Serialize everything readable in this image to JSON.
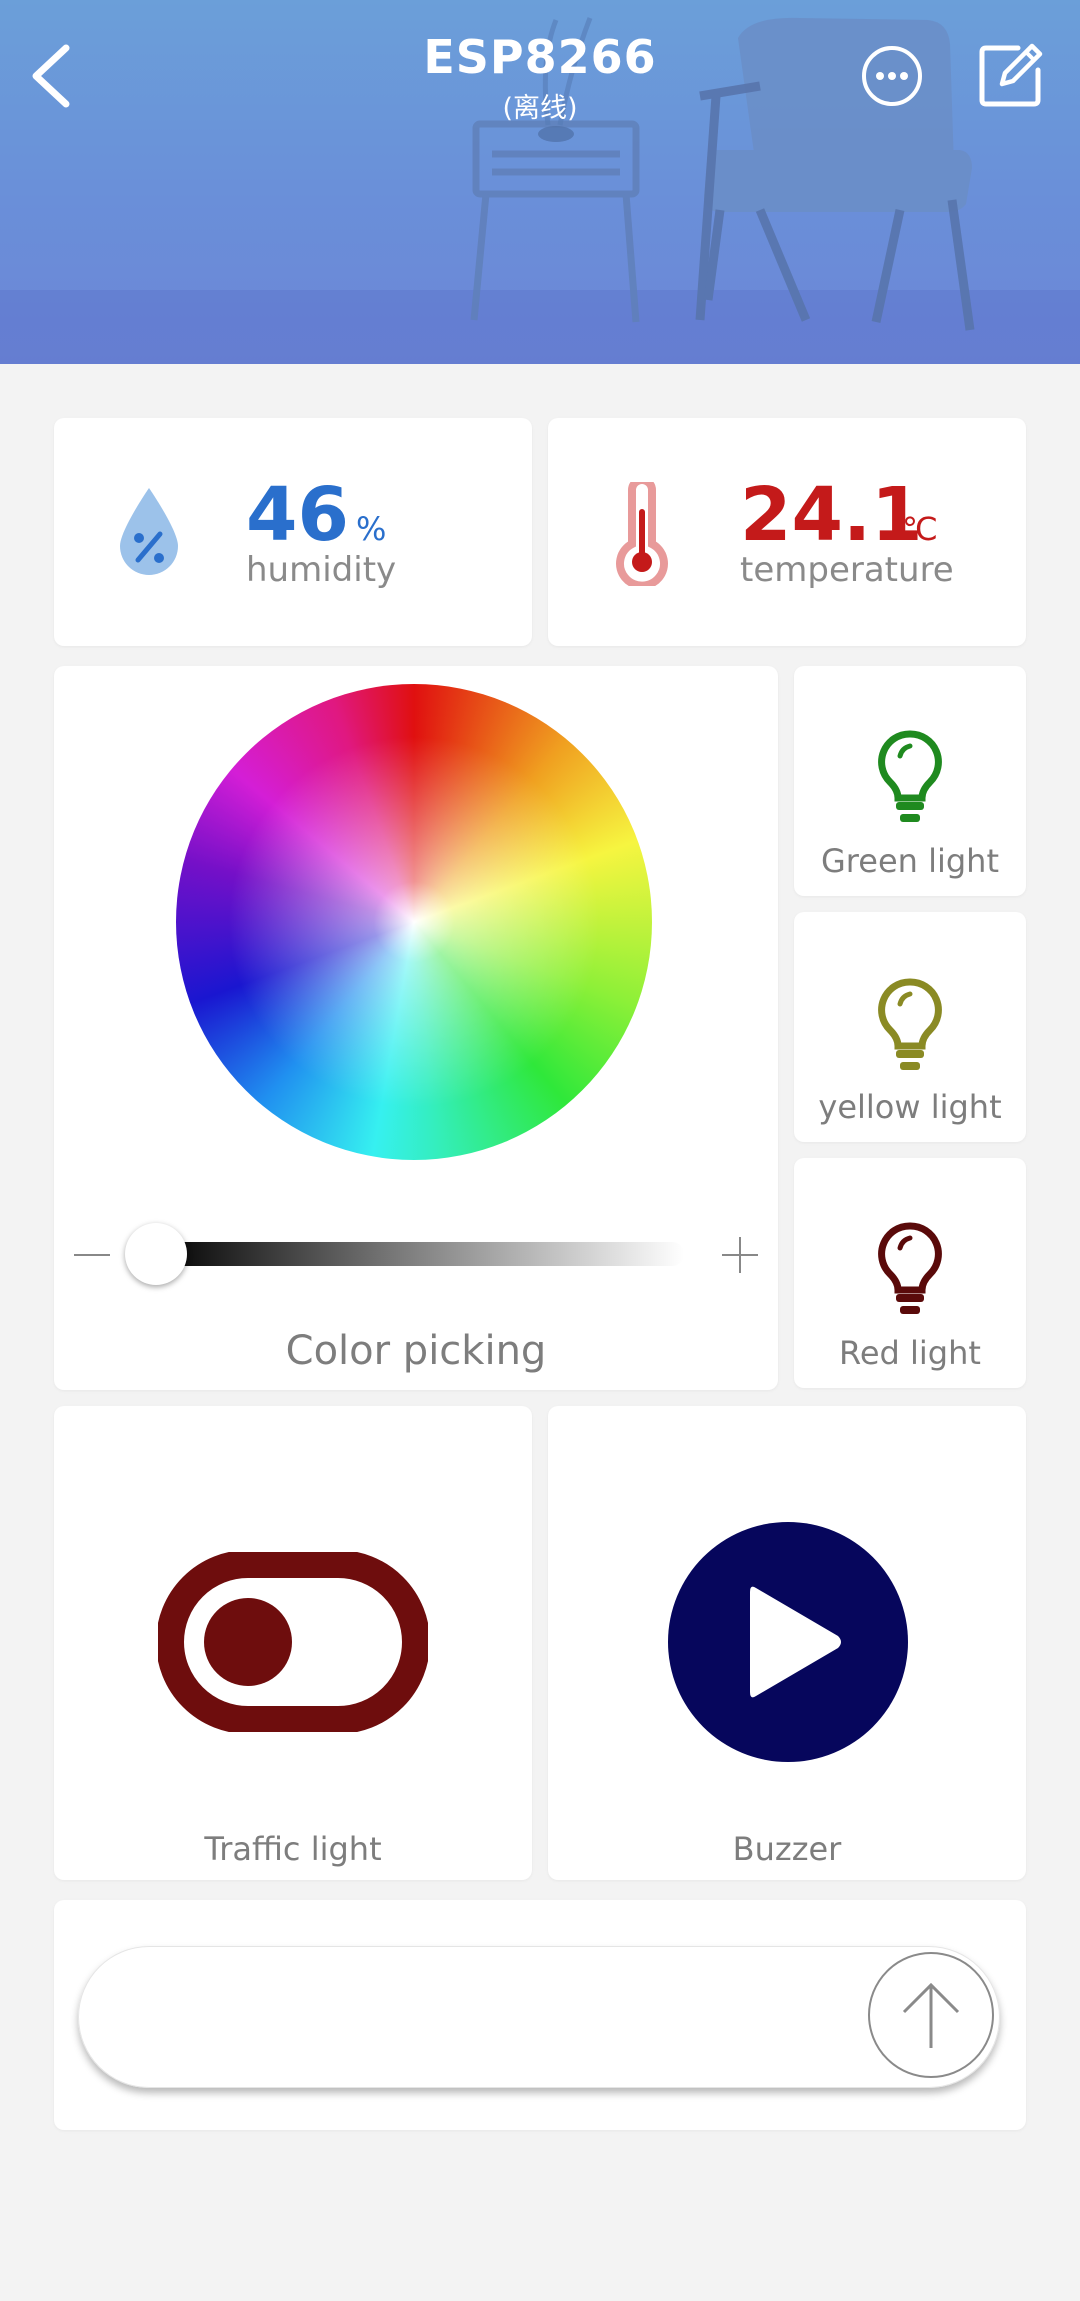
{
  "header": {
    "title": "ESP8266",
    "status": "(离线)",
    "icons": [
      "back-arrow-icon",
      "more-dots-icon",
      "edit-icon"
    ]
  },
  "humidity": {
    "value": "46",
    "unit": "%",
    "label": "humidity",
    "icon": "water-drop-percent-icon",
    "color": "#2a6fcc"
  },
  "temperature": {
    "value": "24.1",
    "unit": "℃",
    "label": "temperature",
    "icon": "thermometer-icon",
    "color": "#c41a1a"
  },
  "color_picker": {
    "label": "Color picking",
    "brightness": 0.0
  },
  "lights": [
    {
      "label": "Green light",
      "color": "#1f8a1f",
      "icon": "bulb-icon"
    },
    {
      "label": "yellow light",
      "color": "#8a8a24",
      "icon": "bulb-icon"
    },
    {
      "label": "Red light",
      "color": "#5a0a0a",
      "icon": "bulb-icon"
    }
  ],
  "traffic_light": {
    "label": "Traffic light",
    "icon": "toggle-switch-icon",
    "color": "#6e0d0d",
    "state": "off"
  },
  "buzzer": {
    "label": "Buzzer",
    "icon": "play-icon",
    "color": "#06065c"
  },
  "message_input": {
    "value": "",
    "placeholder": "",
    "send_icon": "arrow-up-icon"
  }
}
